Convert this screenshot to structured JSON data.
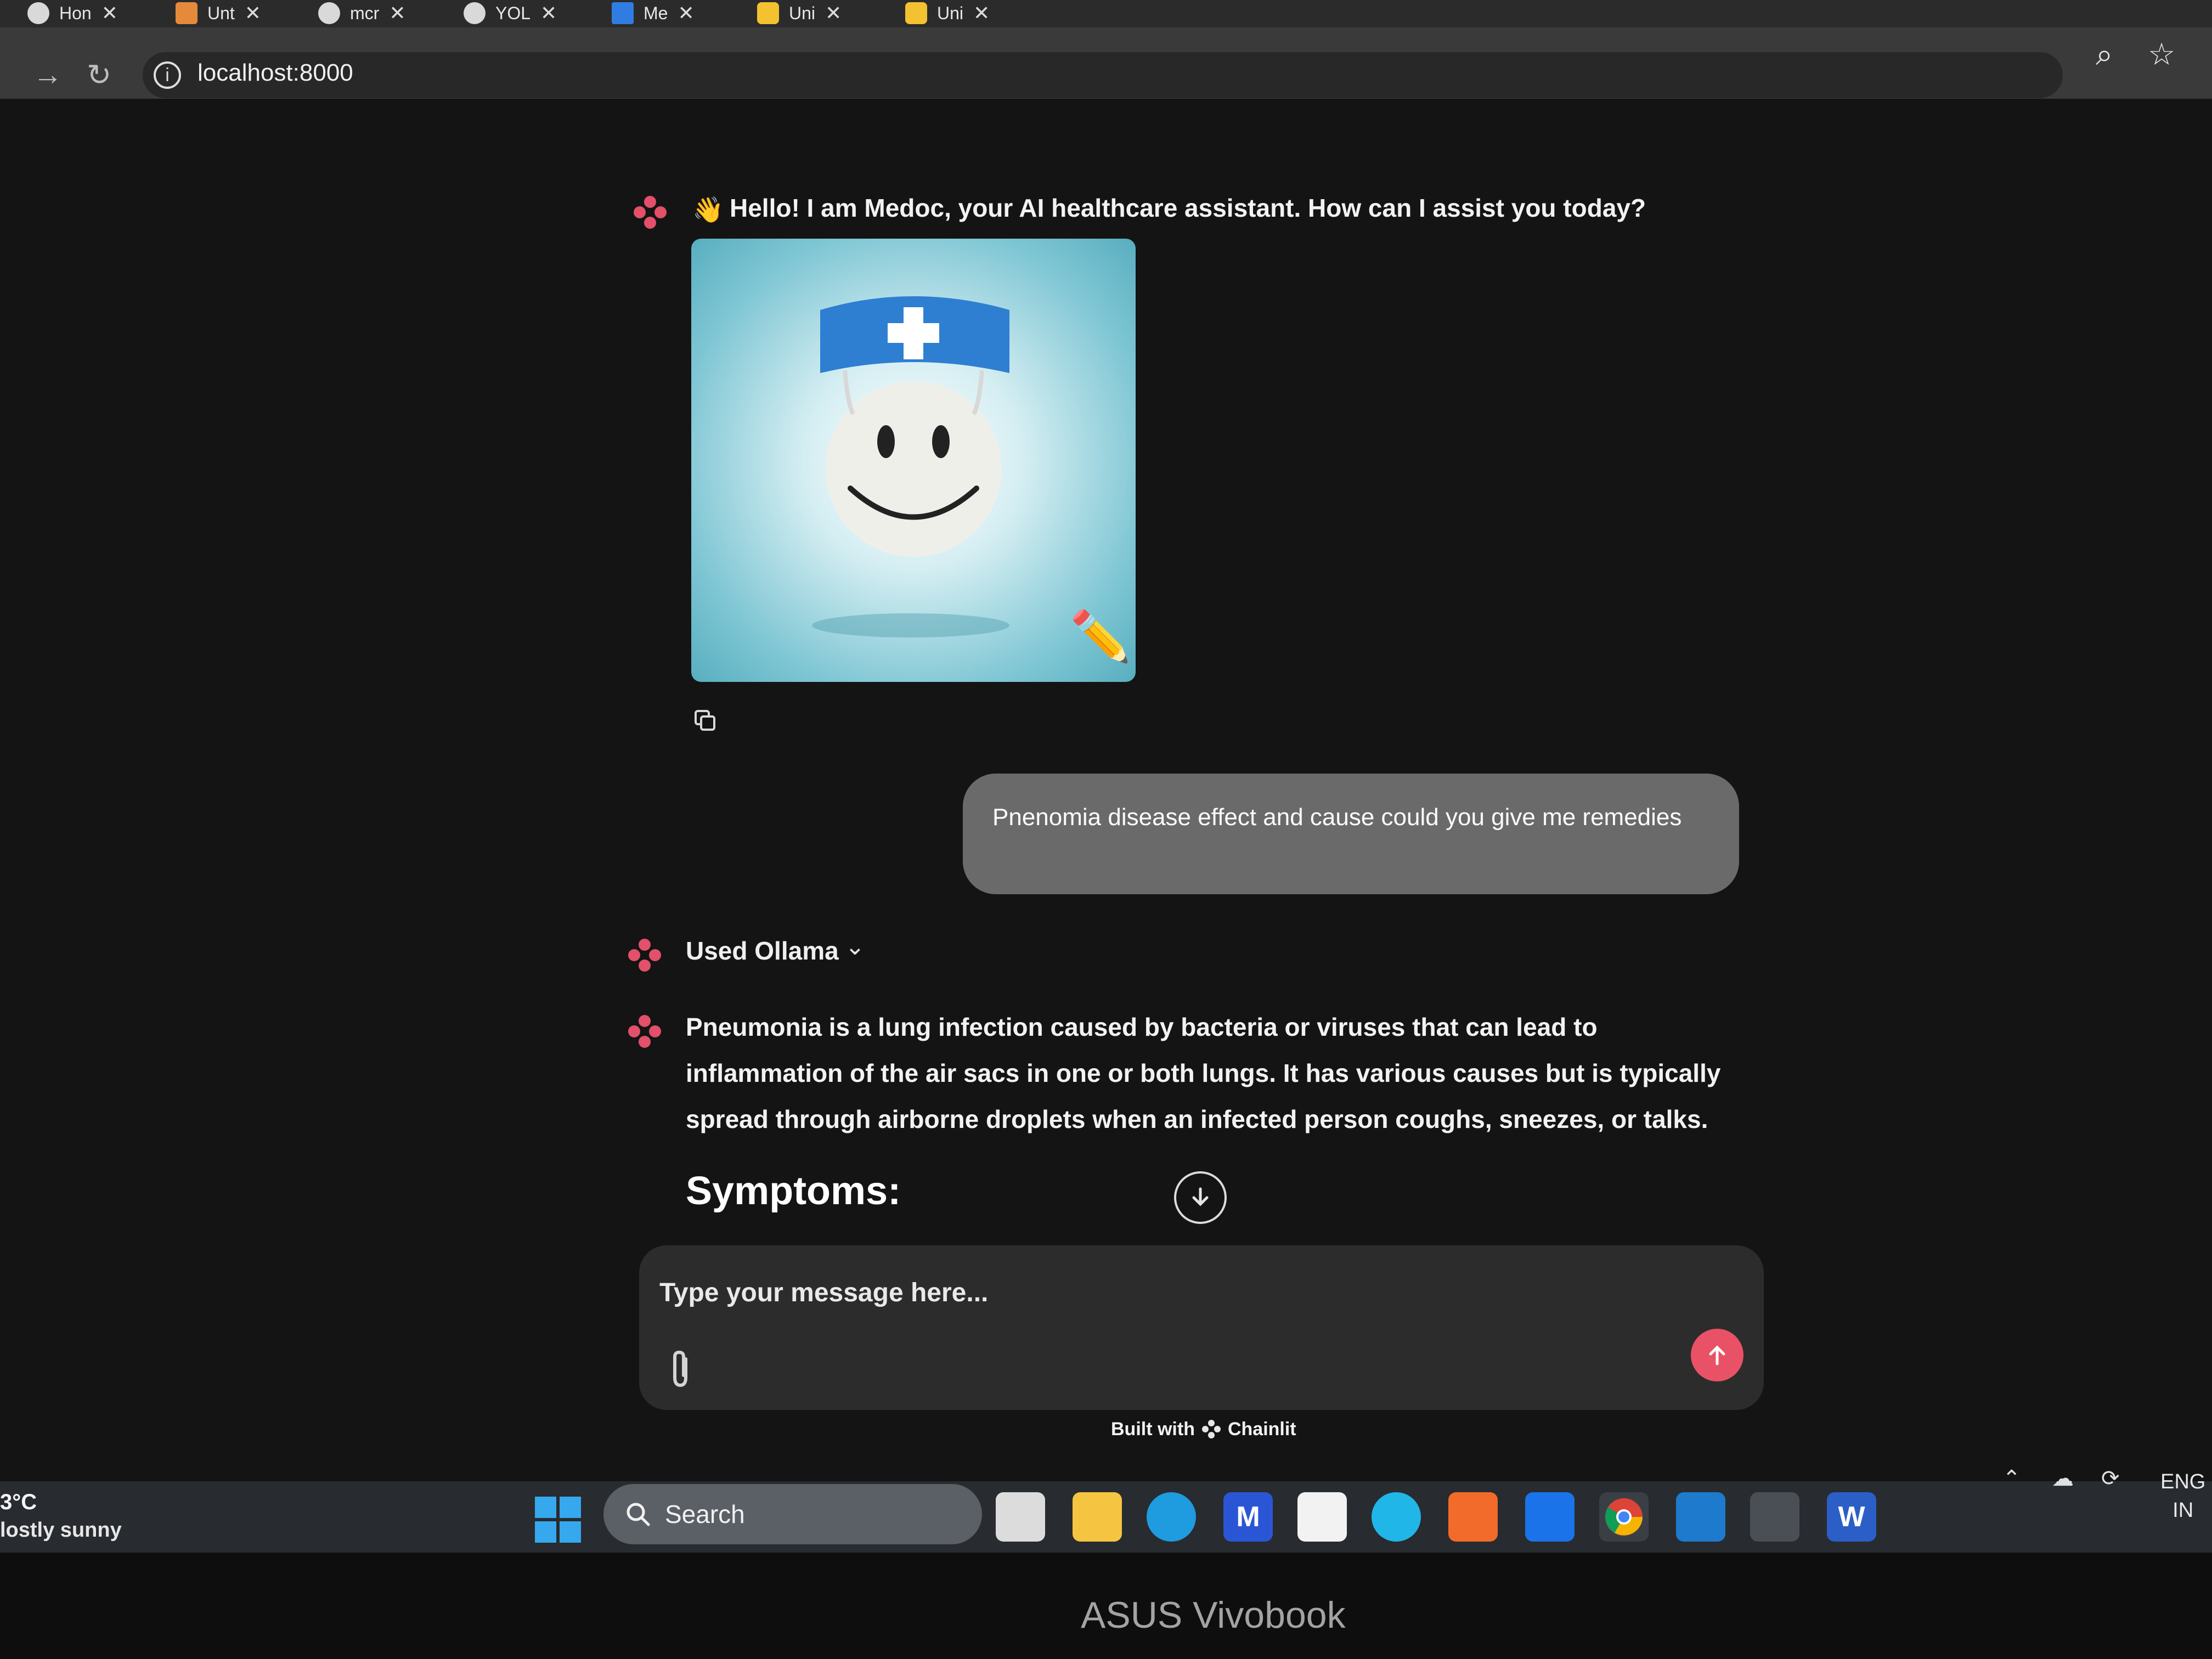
{
  "browser": {
    "tabs": [
      {
        "label": "Hon"
      },
      {
        "label": "Unt"
      },
      {
        "label": "mcr"
      },
      {
        "label": "YOL"
      },
      {
        "label": "Me"
      },
      {
        "label": "Uni"
      },
      {
        "label": "Uni"
      }
    ],
    "url": "localhost:8000"
  },
  "chat": {
    "greeting": "Hello! I am Medoc, your AI healthcare assistant. How can I assist you today?",
    "user_message": "Pnenomia disease effect and cause could you give me remedies",
    "tool_step_label": "Used Ollama",
    "answer": "Pneumonia is a lung infection caused by bacteria or viruses that can lead to inflammation of the air sacs in one or both lungs. It has various causes but is typically spread through airborne droplets when an infected person coughs, sneezes, or talks.",
    "section_heading": "Symptoms:"
  },
  "composer": {
    "placeholder": "Type your message here..."
  },
  "footer": {
    "built_with": "Built with",
    "brand": "Chainlit"
  },
  "taskbar": {
    "weather_temp": "3°C",
    "weather_desc": "lostly sunny",
    "search_label": "Search",
    "lang_line1": "ENG",
    "lang_line2": "IN"
  },
  "device": {
    "brand": "ASUS Vivobook"
  },
  "colors": {
    "accent": "#e95266",
    "user_bubble": "#6a6a6a",
    "app_bg": "#141414"
  }
}
